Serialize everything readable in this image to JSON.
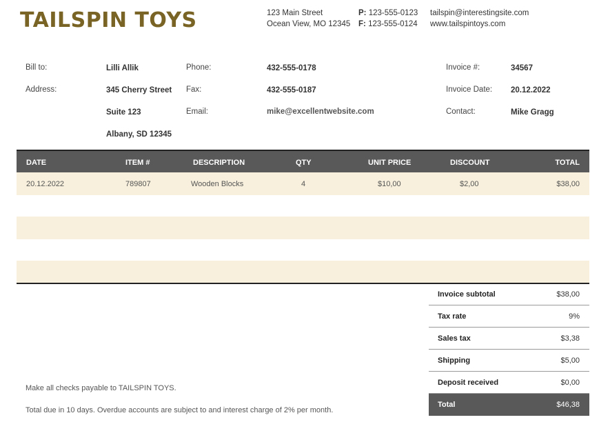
{
  "company": {
    "name": "TAILSPIN TOYS",
    "address_line1": "123 Main Street",
    "address_line2": "Ocean View,  MO 12345",
    "phone_label": "P:",
    "phone": "123-555-0123",
    "fax_label": "F:",
    "fax": "123-555-0124",
    "email": "tailspin@interestingsite.com",
    "website": "www.tailspintoys.com"
  },
  "billing": {
    "bill_to_label": "Bill to:",
    "bill_to": "Lilli Allik",
    "address_label": "Address:",
    "address_line1": "345 Cherry Street",
    "address_line2": "Suite 123",
    "address_line3": "Albany, SD 12345",
    "phone_label": "Phone:",
    "phone": "432-555-0178",
    "fax_label": "Fax:",
    "fax": "432-555-0187",
    "email_label": "Email:",
    "email": "mike@excellentwebsite.com",
    "invoice_no_label": "Invoice #:",
    "invoice_no": "34567",
    "invoice_date_label": "Invoice Date:",
    "invoice_date": "20.12.2022",
    "contact_label": "Contact:",
    "contact": "Mike Gragg"
  },
  "table": {
    "headers": {
      "date": "DATE",
      "item": "ITEM #",
      "description": "DESCRIPTION",
      "qty": "QTY",
      "unit_price": "UNIT PRICE",
      "discount": "DISCOUNT",
      "total": "TOTAL"
    },
    "rows": [
      {
        "date": "20.12.2022",
        "item": "789807",
        "description": "Wooden Blocks",
        "qty": "4",
        "unit_price": "$10,00",
        "discount": "$2,00",
        "total": "$38,00"
      }
    ]
  },
  "summary": {
    "subtotal_label": "Invoice subtotal",
    "subtotal": "$38,00",
    "tax_rate_label": "Tax rate",
    "tax_rate": "9%",
    "sales_tax_label": "Sales tax",
    "sales_tax": "$3,38",
    "shipping_label": "Shipping",
    "shipping": "$5,00",
    "deposit_label": "Deposit received",
    "deposit": "$0,00",
    "total_label": "Total",
    "total": "$46,38"
  },
  "notes": {
    "payable": "Make all checks payable to TAILSPIN TOYS.",
    "terms": "Total due in 10 days. Overdue accounts are subject to and interest charge of 2% per month."
  },
  "colors": {
    "brand": "#7a6425",
    "header_bg": "#595959",
    "band_bg": "#f8f0dc"
  }
}
